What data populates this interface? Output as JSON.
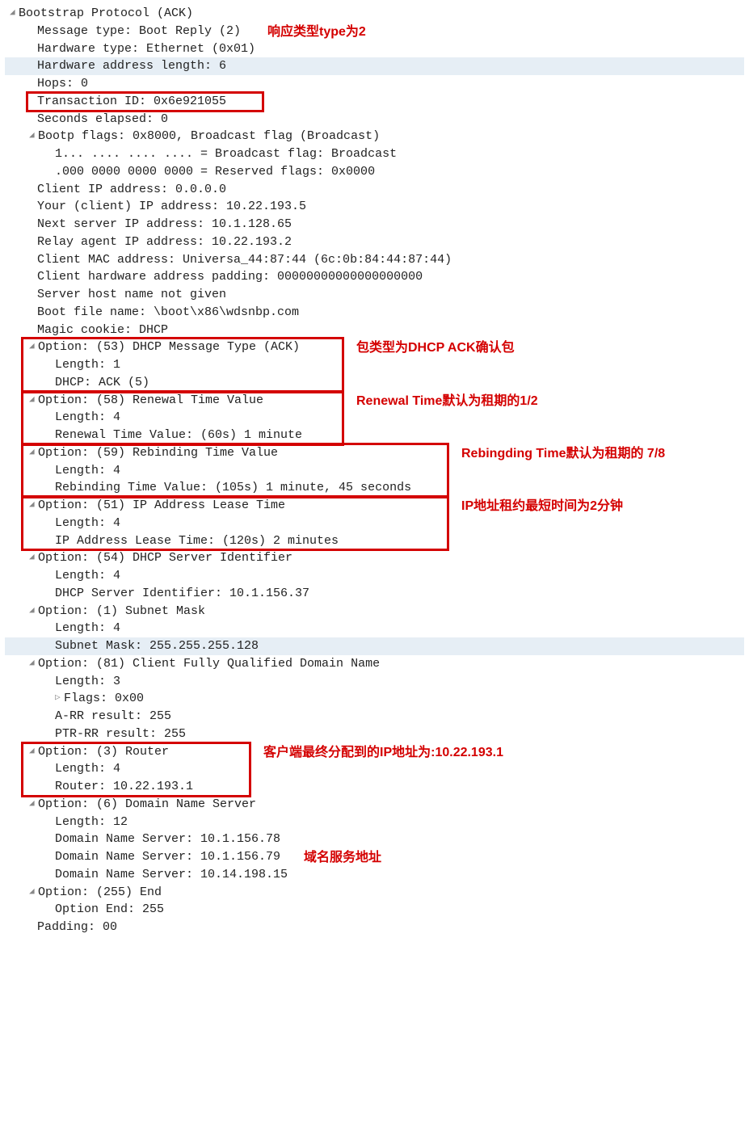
{
  "root": "Bootstrap Protocol (ACK)",
  "hdr": {
    "msg_type": "Message type: Boot Reply (2)",
    "msg_type_annot": "响应类型type为2",
    "hw_type": "Hardware type: Ethernet (0x01)",
    "hw_alen": "Hardware address length: 6",
    "hops": "Hops: 0",
    "xid": "Transaction ID: 0x6e921055",
    "secs": "Seconds elapsed: 0"
  },
  "flags": {
    "line": "Bootp flags: 0x8000, Broadcast flag (Broadcast)",
    "b1": "1... .... .... .... = Broadcast flag: Broadcast",
    "b2": ".000 0000 0000 0000 = Reserved flags: 0x0000"
  },
  "addr": {
    "ciaddr": "Client IP address: 0.0.0.0",
    "yiaddr": "Your (client) IP address: 10.22.193.5",
    "siaddr": "Next server IP address: 10.1.128.65",
    "giaddr": "Relay agent IP address: 10.22.193.2",
    "chaddr": "Client MAC address: Universa_44:87:44 (6c:0b:84:44:87:44)",
    "chpad": "Client hardware address padding: 00000000000000000000",
    "sname": "Server host name not given",
    "file": "Boot file name: \\boot\\x86\\wdsnbp.com",
    "cookie": "Magic cookie: DHCP"
  },
  "opt53": {
    "t": "Option: (53) DHCP Message Type (ACK)",
    "len": "Length: 1",
    "v": "DHCP: ACK (5)",
    "annot": "包类型为DHCP ACK确认包"
  },
  "opt58": {
    "t": "Option: (58) Renewal Time Value",
    "len": "Length: 4",
    "v": "Renewal Time Value: (60s) 1 minute",
    "annot": "Renewal Time默认为租期的1/2"
  },
  "opt59": {
    "t": "Option: (59) Rebinding Time Value",
    "len": "Length: 4",
    "v": "Rebinding Time Value: (105s) 1 minute, 45 seconds",
    "annot": "Rebingding Time默认为租期的 7/8"
  },
  "opt51": {
    "t": "Option: (51) IP Address Lease Time",
    "len": "Length: 4",
    "v": "IP Address Lease Time: (120s) 2 minutes",
    "annot": "IP地址租约最短时间为2分钟"
  },
  "opt54": {
    "t": "Option: (54) DHCP Server Identifier",
    "len": "Length: 4",
    "v": "DHCP Server Identifier: 10.1.156.37"
  },
  "opt1": {
    "t": "Option: (1) Subnet Mask",
    "len": "Length: 4",
    "v": "Subnet Mask: 255.255.255.128"
  },
  "opt81": {
    "t": "Option: (81) Client Fully Qualified Domain Name",
    "len": "Length: 3",
    "flags": "Flags: 0x00",
    "a": "A-RR result: 255",
    "ptr": "PTR-RR result: 255"
  },
  "opt3": {
    "t": "Option: (3) Router",
    "len": "Length: 4",
    "v": "Router: 10.22.193.1",
    "annot": "客户端最终分配到的IP地址为:10.22.193.1"
  },
  "opt6": {
    "t": "Option: (6) Domain Name Server",
    "len": "Length: 12",
    "v1": "Domain Name Server: 10.1.156.78",
    "v2": "Domain Name Server: 10.1.156.79",
    "v3": "Domain Name Server: 10.14.198.15",
    "annot": "域名服务地址"
  },
  "opt255": {
    "t": "Option: (255) End",
    "v": "Option End: 255"
  },
  "padding": "Padding: 00"
}
